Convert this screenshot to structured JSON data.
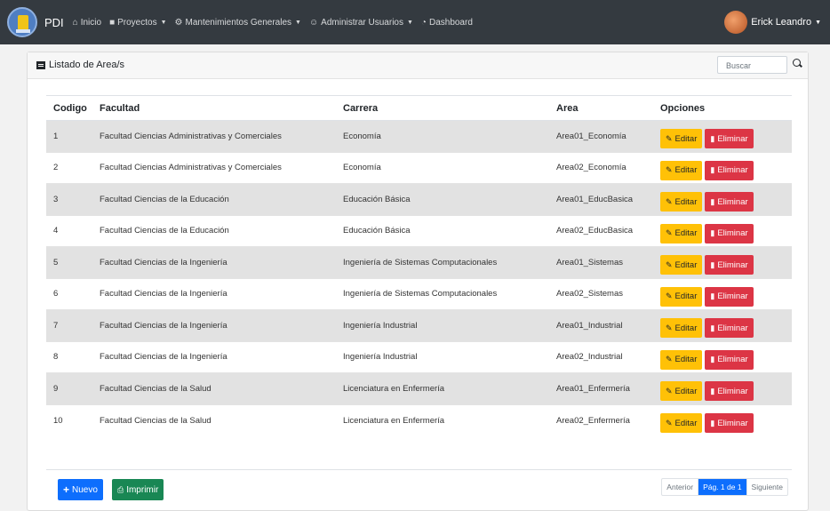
{
  "navbar": {
    "brand": "PDI",
    "items": [
      {
        "icon": "home-icon",
        "glyph": "⌂",
        "label": "Inicio",
        "dropdown": false
      },
      {
        "icon": "folder-icon",
        "glyph": "■",
        "label": "Proyectos",
        "dropdown": true
      },
      {
        "icon": "cogs-icon",
        "glyph": "⚙",
        "label": "Mantenimientos Generales",
        "dropdown": true
      },
      {
        "icon": "users-icon",
        "glyph": "☺",
        "label": "Administrar Usuarios",
        "dropdown": true
      },
      {
        "icon": "dashboard-icon",
        "glyph": "◔",
        "label": "Dashboard",
        "dropdown": false
      }
    ],
    "user": "Erick Leandro"
  },
  "card": {
    "title": "Listado de Area/s",
    "search_placeholder": "Buscar"
  },
  "table": {
    "headers": [
      "Codigo",
      "Facultad",
      "Carrera",
      "Area",
      "Opciones"
    ],
    "rows": [
      [
        "1",
        "Facultad Ciencias Administrativas y Comerciales",
        "Economía",
        "Area01_Economía"
      ],
      [
        "2",
        "Facultad Ciencias Administrativas y Comerciales",
        "Economía",
        "Area02_Economía"
      ],
      [
        "3",
        "Facultad Ciencias de la Educación",
        "Educación Básica",
        "Area01_EducBasica"
      ],
      [
        "4",
        "Facultad Ciencias de la Educación",
        "Educación Básica",
        "Area02_EducBasica"
      ],
      [
        "5",
        "Facultad Ciencias de la Ingeniería",
        "Ingeniería de Sistemas Computacionales",
        "Area01_Sistemas"
      ],
      [
        "6",
        "Facultad Ciencias de la Ingeniería",
        "Ingeniería de Sistemas Computacionales",
        "Area02_Sistemas"
      ],
      [
        "7",
        "Facultad Ciencias de la Ingeniería",
        "Ingeniería Industrial",
        "Area01_Industrial"
      ],
      [
        "8",
        "Facultad Ciencias de la Ingeniería",
        "Ingeniería Industrial",
        "Area02_Industrial"
      ],
      [
        "9",
        "Facultad Ciencias de la Salud",
        "Licenciatura en Enfermería",
        "Area01_Enfermería"
      ],
      [
        "10",
        "Facultad Ciencias de la Salud",
        "Licenciatura en Enfermería",
        "Area02_Enfermería"
      ]
    ],
    "edit_label": "Editar",
    "delete_label": "Eliminar"
  },
  "footer": {
    "new_label": "Nuevo",
    "print_label": "Imprimir",
    "pagination": {
      "prev": "Anterior",
      "current": "Pág. 1 de 1",
      "next": "Siguiente"
    }
  },
  "colors": {
    "navbar": "#343a40",
    "edit": "#ffc107",
    "delete": "#dc3545",
    "new": "#0d6efd",
    "print": "#198754"
  }
}
